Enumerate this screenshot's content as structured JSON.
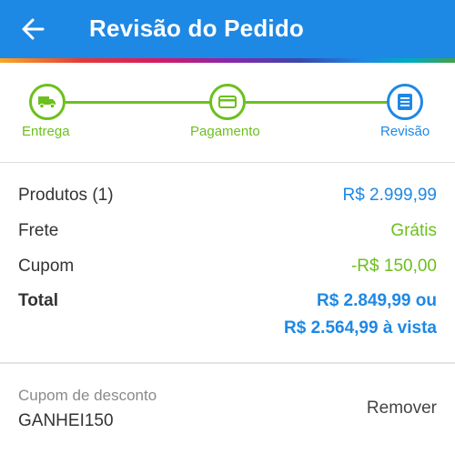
{
  "header": {
    "title": "Revisão do Pedido",
    "back_icon": "arrow-left-icon",
    "background_color": "#1E88E5"
  },
  "stepper": {
    "steps": [
      {
        "label": "Entrega",
        "icon": "truck-icon",
        "state": "completed"
      },
      {
        "label": "Pagamento",
        "icon": "credit-card-icon",
        "state": "completed"
      },
      {
        "label": "Revisão",
        "icon": "document-icon",
        "state": "active"
      }
    ],
    "completed_color": "#6CC01D",
    "active_color": "#1E88E5"
  },
  "summary": {
    "products_label": "Produtos (1)",
    "products_value": "R$ 2.999,99",
    "shipping_label": "Frete",
    "shipping_value": "Grátis",
    "coupon_label": "Cupom",
    "coupon_value": "-R$ 150,00",
    "total_label": "Total",
    "total_value_line1": "R$ 2.849,99 ou",
    "total_value_line2": "R$ 2.564,99 à vista"
  },
  "coupon": {
    "label": "Cupom de desconto",
    "code": "GANHEI150",
    "remove_label": "Remover"
  }
}
